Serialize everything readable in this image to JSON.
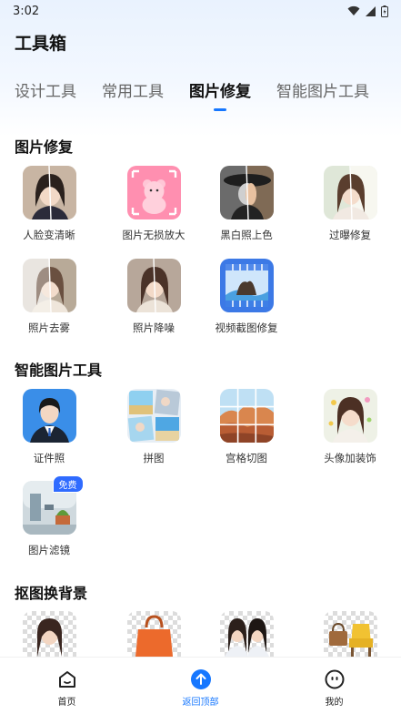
{
  "status_bar": {
    "time": "3:02"
  },
  "header": {
    "title": "工具箱"
  },
  "tabs": [
    {
      "label": "设计工具"
    },
    {
      "label": "常用工具"
    },
    {
      "label": "图片修复"
    },
    {
      "label": "智能图片工具"
    }
  ],
  "sections": {
    "repair": {
      "title": "图片修复",
      "items": [
        {
          "label": "人脸变清晰"
        },
        {
          "label": "图片无损放大"
        },
        {
          "label": "黑白照上色"
        },
        {
          "label": "过曝修复"
        },
        {
          "label": "照片去雾"
        },
        {
          "label": "照片降噪"
        },
        {
          "label": "视频截图修复"
        }
      ]
    },
    "smart": {
      "title": "智能图片工具",
      "items": [
        {
          "label": "证件照"
        },
        {
          "label": "拼图"
        },
        {
          "label": "宫格切图"
        },
        {
          "label": "头像加装饰"
        },
        {
          "label": "图片滤镜",
          "badge": "免费"
        }
      ]
    },
    "cutout": {
      "title": "抠图换背景"
    }
  },
  "bottom_nav": [
    {
      "label": "首页",
      "icon": "home-icon"
    },
    {
      "label": "返回顶部",
      "icon": "arrow-up-icon"
    },
    {
      "label": "我的",
      "icon": "profile-icon"
    }
  ],
  "colors": {
    "accent": "#1677ff",
    "badge": "#2f6bff"
  }
}
